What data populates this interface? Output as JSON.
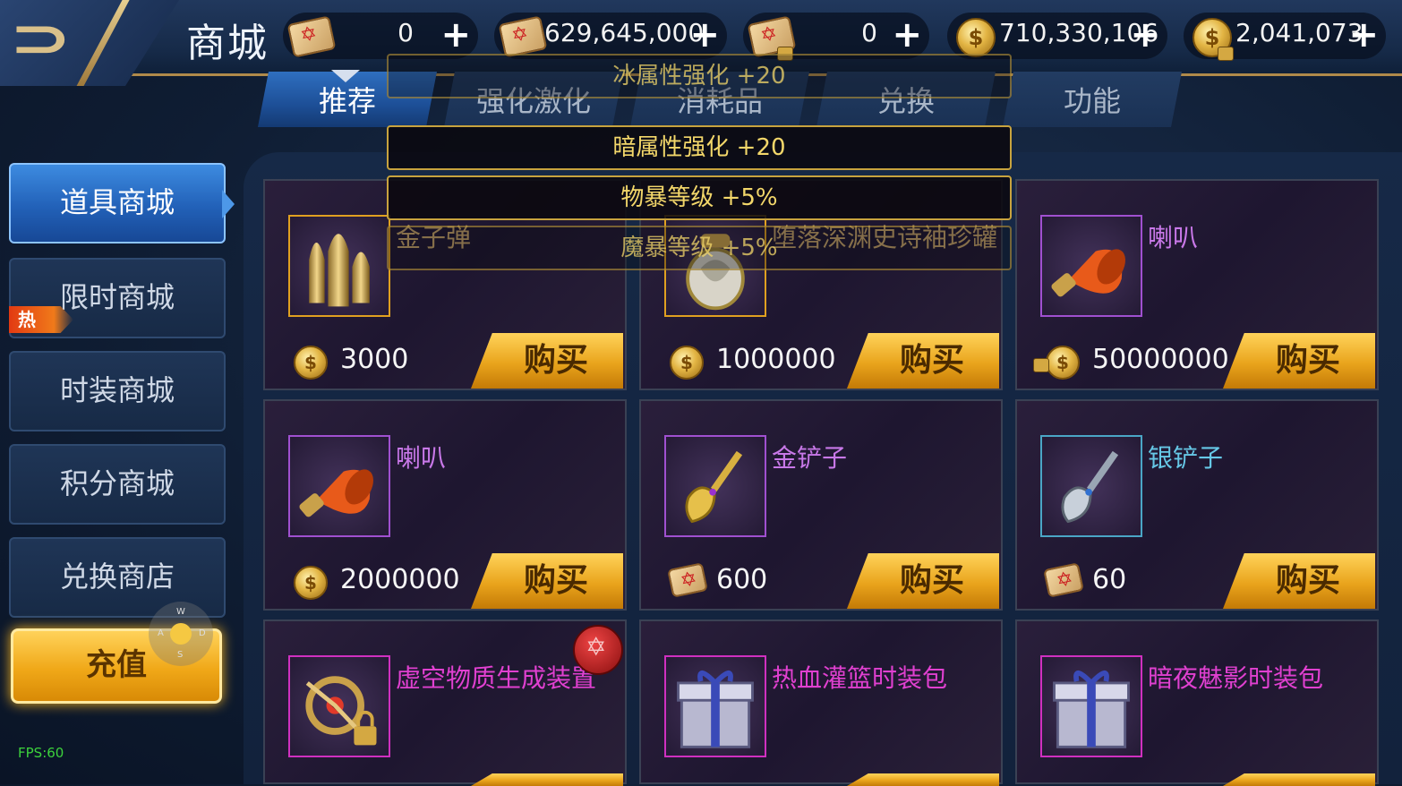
{
  "header": {
    "title": "商城",
    "currencies": [
      {
        "icon": "scroll-icon",
        "value": "0"
      },
      {
        "icon": "scroll-icon",
        "value": "629,645,000"
      },
      {
        "icon": "locked-scroll-icon",
        "value": "0"
      },
      {
        "icon": "gold-coin-icon",
        "value": "710,330,106"
      },
      {
        "icon": "locked-gold-coin-icon",
        "value": "2,041,073"
      }
    ],
    "plus": "+"
  },
  "tabs": [
    "推荐",
    "强化激化",
    "消耗品",
    "兑换",
    "功能"
  ],
  "sidebar": {
    "items": [
      "道具商城",
      "限时商城",
      "时装商城",
      "积分商城",
      "兑换商店"
    ],
    "hot_badge": "热",
    "recharge": "充值"
  },
  "joystick": {
    "w": "W",
    "a": "A",
    "s": "S",
    "d": "D"
  },
  "fps": "FPS:60",
  "tooltip": [
    "冰属性强化 +20",
    "暗属性强化 +20",
    "物暴等级 +5%",
    "魔暴等级 +5%"
  ],
  "buy_label": "购买",
  "items": [
    {
      "name": "金子弹",
      "price": "3000",
      "currency": "gold-coin-icon",
      "name_color": "#c9a76a",
      "frame_color": "#e0a020"
    },
    {
      "name": "堕落深渊史诗袖珍罐",
      "price": "1000000",
      "currency": "gold-coin-icon",
      "name_color": "#c9a76a",
      "frame_color": "#e0a020"
    },
    {
      "name": "喇叭",
      "price": "50000000",
      "currency": "locked-gold-coin-icon",
      "name_color": "#c878e8",
      "frame_color": "#a050d0"
    },
    {
      "name": "喇叭",
      "price": "2000000",
      "currency": "gold-coin-icon",
      "name_color": "#c878e8",
      "frame_color": "#a050d0"
    },
    {
      "name": "金铲子",
      "price": "600",
      "currency": "scroll-icon",
      "name_color": "#c878e8",
      "frame_color": "#a050d0"
    },
    {
      "name": "银铲子",
      "price": "60",
      "currency": "scroll-icon",
      "name_color": "#66c8e6",
      "frame_color": "#4aa6c6"
    },
    {
      "name": "虚空物质生成装置",
      "price": "",
      "currency": "",
      "name_color": "#e040d0",
      "frame_color": "#d030c0"
    },
    {
      "name": "热血灌篮时装包",
      "price": "",
      "currency": "",
      "name_color": "#e040d0",
      "frame_color": "#d030c0"
    },
    {
      "name": "暗夜魅影时装包",
      "price": "",
      "currency": "",
      "name_color": "#e040d0",
      "frame_color": "#d030c0"
    }
  ]
}
